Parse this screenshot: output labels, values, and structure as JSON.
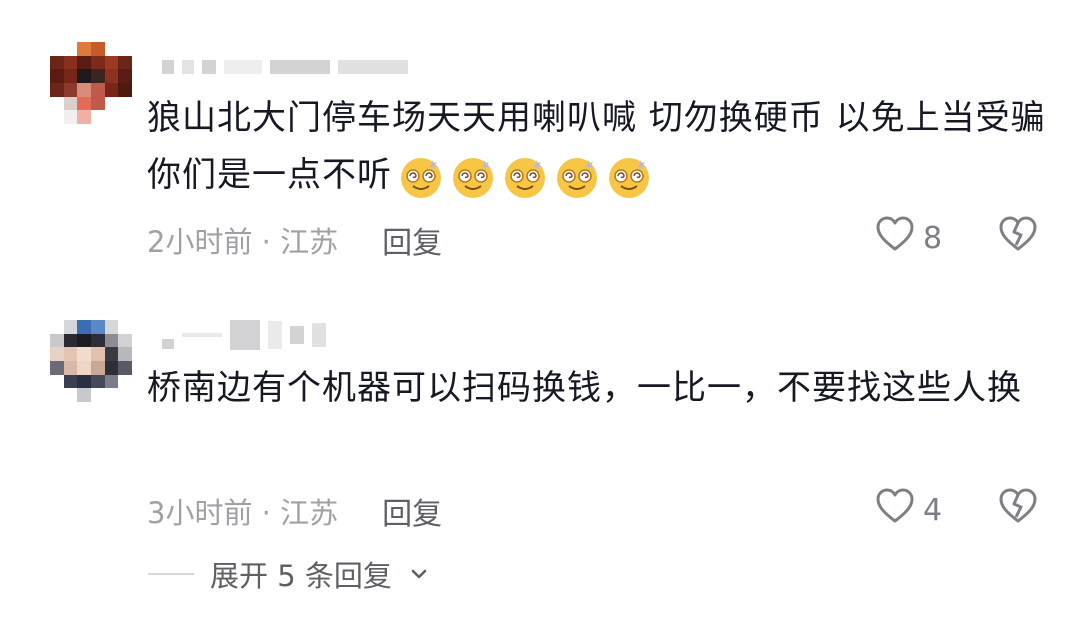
{
  "comments": [
    {
      "text": "狼山北大门停车场天天用喇叭喊 切勿换硬币  以免上当受骗 你们是一点不听",
      "emoji_count": 5,
      "emoji_icon": "dizzy-smile-emoji",
      "time_location": "2小时前 · 江苏",
      "reply_label": "回复",
      "like_count": "8"
    },
    {
      "text": "桥南边有个机器可以扫码换钱，一比一，不要找这些人换",
      "time_location": "3小时前 · 江苏",
      "reply_label": "回复",
      "like_count": "4"
    }
  ],
  "expand_replies": {
    "label": "展开 5 条回复"
  },
  "icons": {
    "like": "heart-outline-icon",
    "dislike": "broken-heart-icon",
    "expand": "chevron-down-icon"
  },
  "colors": {
    "text_primary": "#161823",
    "text_secondary": "#a0a1a7",
    "emoji_yellow": "#f7c646"
  }
}
